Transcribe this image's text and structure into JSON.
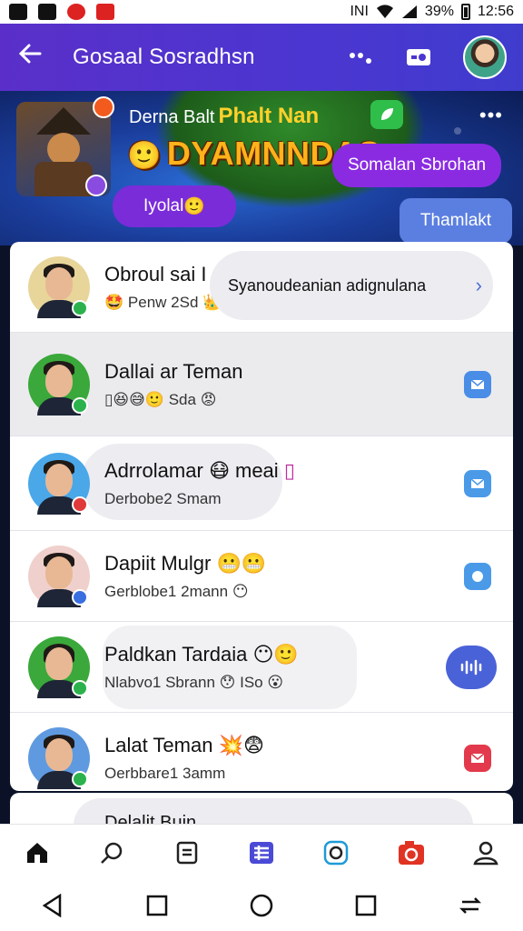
{
  "status_bar": {
    "network": "INI",
    "battery": "39%",
    "time": "12:56"
  },
  "header": {
    "title": "Gosaal Sosradhsn",
    "back_icon": "arrow-left-icon",
    "actions": [
      "share-icon",
      "media-icon",
      "profile-avatar"
    ]
  },
  "banner": {
    "top_text": "Derna Balt",
    "top_highlight": "Phalt Nan",
    "big_text": "DYAMNNDAS",
    "big_emoji": "🙂",
    "bubble_right": "Somalan Sbrohan",
    "bubble_left": "Iyolal",
    "bubble_left_emoji": "🙂",
    "bubble_small": "Thamlakt",
    "more": "•••"
  },
  "chats": [
    {
      "name": "Obroul sai I",
      "preview": "Penw 2Sd",
      "preview_emoji_before": "🤩",
      "preview_emoji_after": "👑",
      "bubble_text": "Syanoudeanian adignulana",
      "status_color": "#2bb24c"
    },
    {
      "name": "Dallai ar Teman",
      "preview": "Sda",
      "preview_emojis": "▯😆😅🙂",
      "preview_emoji_after": "😡",
      "status_color": "#2bb24c"
    },
    {
      "name": "Adrrolamar",
      "name_emoji": "😷",
      "name_suffix": "meai",
      "name_tail_emoji": "▯",
      "preview": "Derbobe2 Smam",
      "status_color": "#e03a3a"
    },
    {
      "name": "Dapiit Mulgr",
      "name_emoji": "😬😬",
      "preview": "Gerblobe1 2mann",
      "preview_emoji_after": "😶",
      "status_color": "#3a6fe0"
    },
    {
      "name": "Paldkan Tardaia",
      "name_emoji": "😶🙂",
      "preview": "Nlabvo1 Sbrann",
      "preview_emoji_mid": "😯",
      "preview_suffix": "ISo",
      "preview_emoji_after": "😮",
      "status_color": "#2bb24c"
    },
    {
      "name": "Lalat Teman",
      "name_emoji": "💥😨",
      "preview": "Oerbbare1 3amm",
      "status_color": "#2bb24c"
    }
  ],
  "partial_row": {
    "name": "Delalit Buin"
  },
  "bottom_nav": [
    "home-icon",
    "search-icon",
    "document-icon",
    "grid-icon",
    "instagram-icon",
    "camera-icon",
    "profile-icon"
  ],
  "colors": {
    "header": "#4b36d1",
    "accent": "#4a62d8",
    "online": "#2bb24c"
  }
}
